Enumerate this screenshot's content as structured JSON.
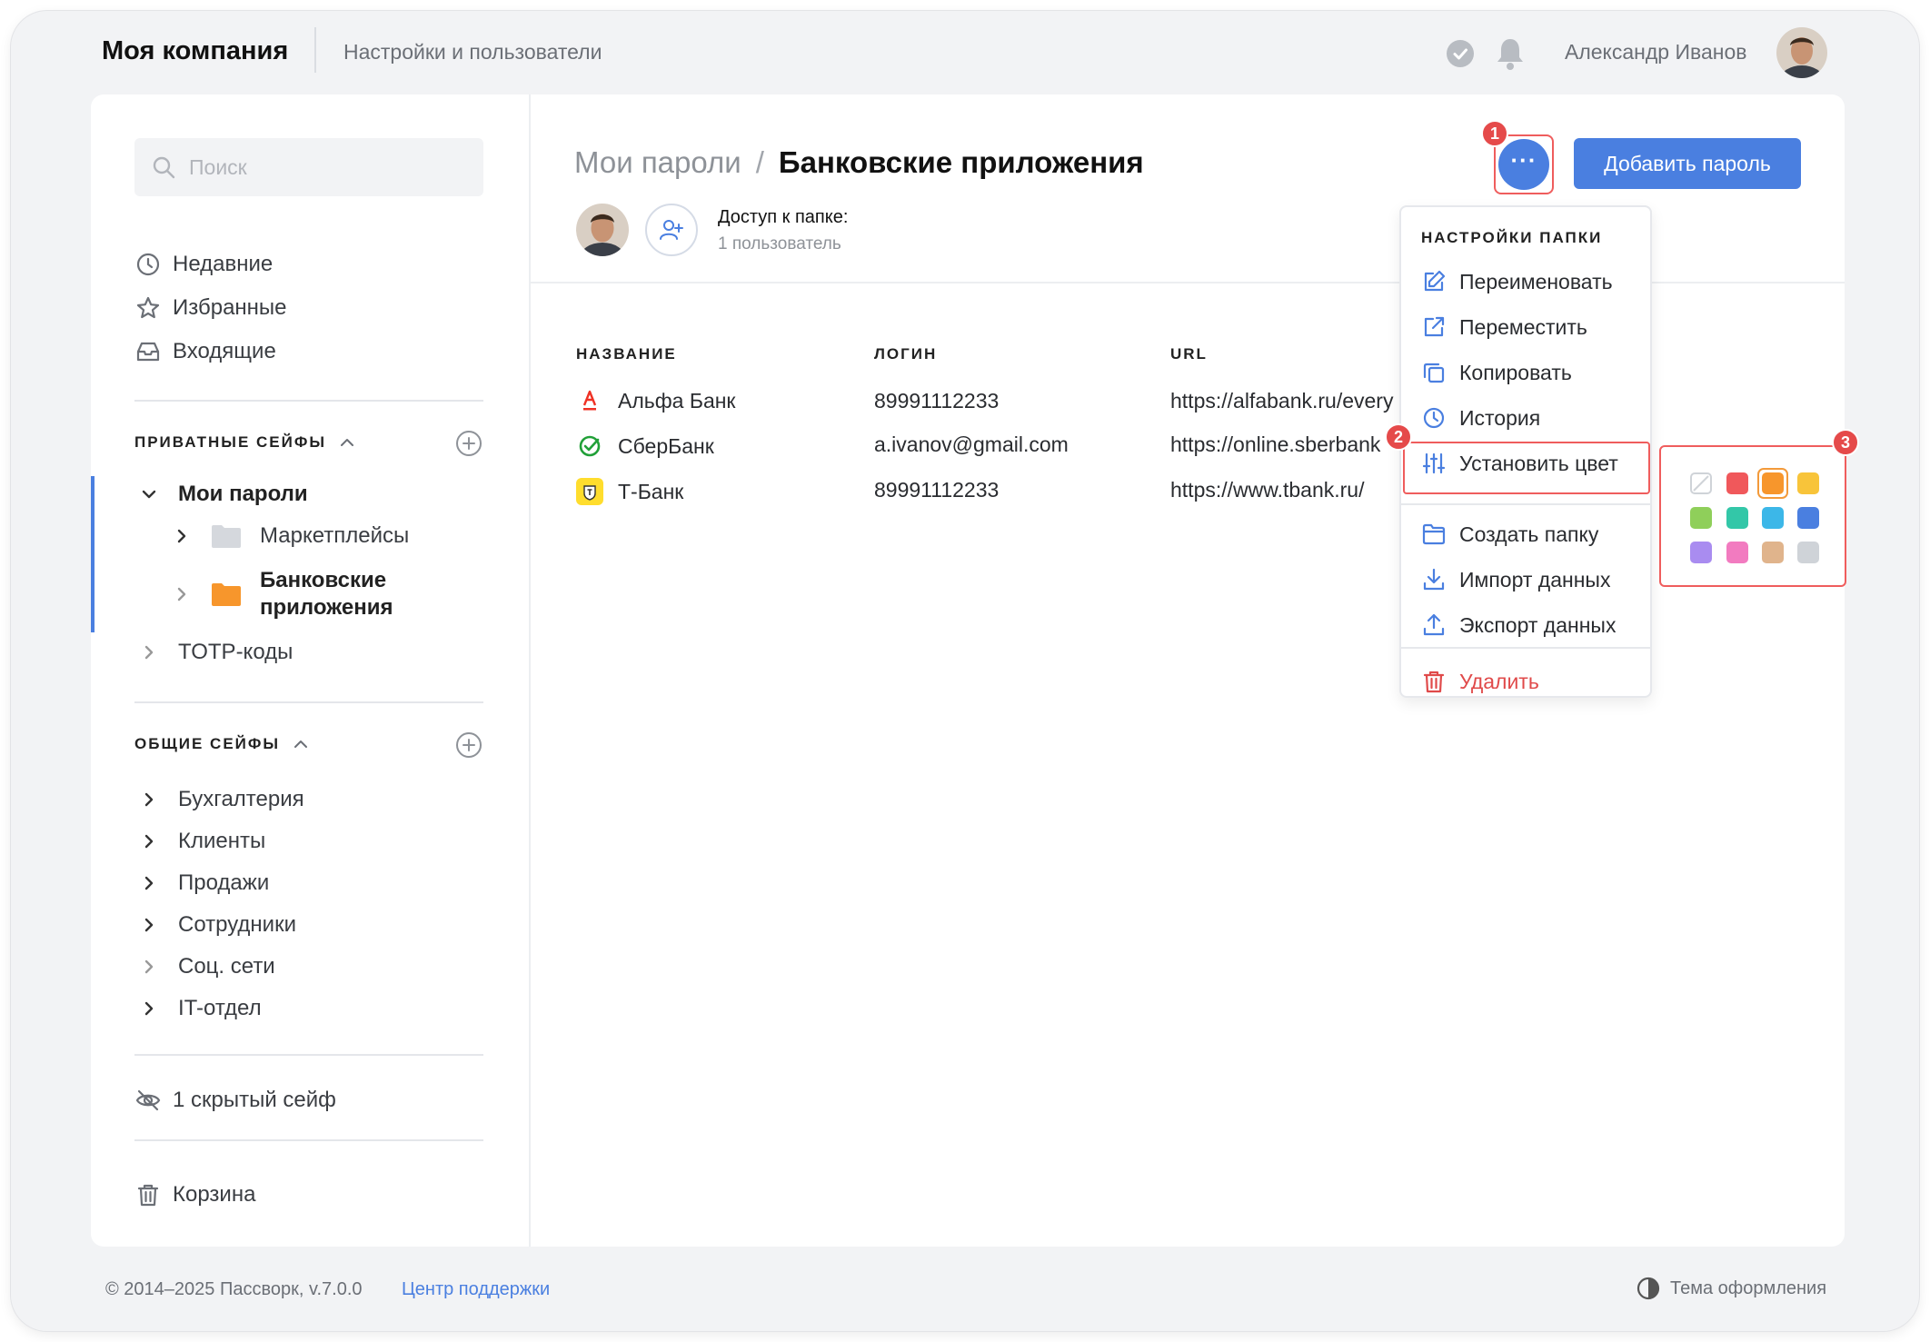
{
  "header": {
    "brand": "Моя компания",
    "subtitle": "Настройки и пользователи",
    "user_name": "Александр Иванов"
  },
  "sidebar": {
    "search_placeholder": "Поиск",
    "quick": [
      {
        "label": "Недавние",
        "icon": "clock-icon"
      },
      {
        "label": "Избранные",
        "icon": "star-icon"
      },
      {
        "label": "Входящие",
        "icon": "inbox-icon"
      }
    ],
    "private_title": "ПРИВАТНЫЕ СЕЙФЫ",
    "my_passwords": "Мои пароли",
    "marketplaces": "Маркетплейсы",
    "bank_apps_1": "Банковские",
    "bank_apps_2": "приложения",
    "totp": "TOTP-коды",
    "shared_title": "ОБЩИЕ СЕЙФЫ",
    "shared": [
      "Бухгалтерия",
      "Клиенты",
      "Продажи",
      "Сотрудники",
      "Соц. сети",
      "IT-отдел"
    ],
    "hidden": "1 скрытый сейф",
    "trash": "Корзина"
  },
  "content": {
    "breadcrumb_root": "Мои пароли",
    "breadcrumb_sep": "/",
    "breadcrumb_current": "Банковские приложения",
    "access_label": "Доступ к папке:",
    "access_count": "1 пользователь",
    "add_button": "Добавить пароль",
    "more_button": "···",
    "columns": {
      "name": "НАЗВАНИЕ",
      "login": "ЛОГИН",
      "url": "URL"
    },
    "rows": [
      {
        "name": "Альфа Банк",
        "login": "89991112233",
        "url": "https://alfabank.ru/every"
      },
      {
        "name": "СберБанк",
        "login": "a.ivanov@gmail.com",
        "url": "https://online.sberbank"
      },
      {
        "name": "Т-Банк",
        "login": "89991112233",
        "url": "https://www.tbank.ru/"
      }
    ]
  },
  "menu": {
    "title": "НАСТРОЙКИ ПАПКИ",
    "rename": "Переименовать",
    "move": "Переместить",
    "copy": "Копировать",
    "history": "История",
    "set_color": "Установить цвет",
    "create_folder": "Создать папку",
    "import": "Импорт данных",
    "export": "Экспорт данных",
    "delete": "Удалить"
  },
  "palette": {
    "colors": [
      "none",
      "#f0585b",
      "#f7962c",
      "#f8c43a",
      "#8fcf5a",
      "#33c7a8",
      "#3cb7e8",
      "#4a7fe0",
      "#a98cf0",
      "#f27bc0",
      "#e0b48c",
      "#cfd3d8"
    ],
    "selected": "#f7962c"
  },
  "badges": [
    "1",
    "2",
    "3"
  ],
  "footer": {
    "copyright": "© 2014–2025 Пассворк, v.7.0.0",
    "support": "Центр поддержки",
    "theme": "Тема оформления"
  }
}
